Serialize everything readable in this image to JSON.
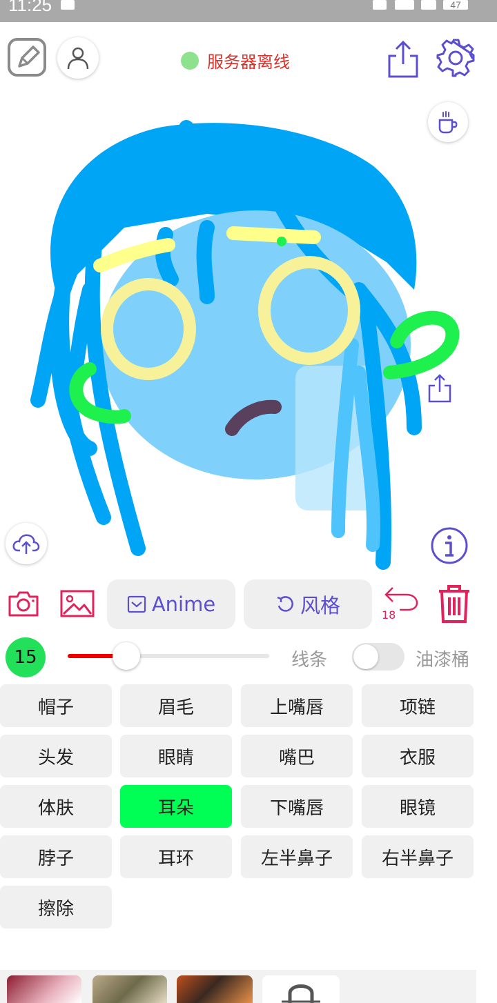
{
  "status_bar": {
    "time": "11:25",
    "battery": "47"
  },
  "header": {
    "server_status": "服务器离线",
    "server_status_color": "#d8322b",
    "server_dot_color": "#8ee28e",
    "icons": [
      "edit-icon",
      "user-icon",
      "share-icon",
      "settings-icon",
      "coffee-icon"
    ]
  },
  "canvas": {
    "side_icons": [
      "upload-cloud-icon",
      "share-icon",
      "info-icon"
    ]
  },
  "toolbar": {
    "anime_label": "Anime",
    "style_label": "风格",
    "undo_count": "18",
    "accent_color": "#5b4fd0",
    "danger_color": "#e0235a"
  },
  "brush": {
    "size": "15",
    "slider_fraction": 0.29,
    "line_label": "线条",
    "bucket_label": "油漆桶",
    "bucket_enabled": false
  },
  "parts": [
    {
      "label": "帽子",
      "selected": false
    },
    {
      "label": "眉毛",
      "selected": false
    },
    {
      "label": "上嘴唇",
      "selected": false
    },
    {
      "label": "项链",
      "selected": false
    },
    {
      "label": "头发",
      "selected": false
    },
    {
      "label": "眼睛",
      "selected": false
    },
    {
      "label": "嘴巴",
      "selected": false
    },
    {
      "label": "衣服",
      "selected": false
    },
    {
      "label": "体肤",
      "selected": false
    },
    {
      "label": "耳朵",
      "selected": true
    },
    {
      "label": "下嘴唇",
      "selected": false
    },
    {
      "label": "眼镜",
      "selected": false
    },
    {
      "label": "脖子",
      "selected": false
    },
    {
      "label": "耳环",
      "selected": false
    },
    {
      "label": "左半鼻子",
      "selected": false
    },
    {
      "label": "右半鼻子",
      "selected": false
    },
    {
      "label": "擦除",
      "selected": false
    }
  ],
  "selected_color": "#00ff55"
}
